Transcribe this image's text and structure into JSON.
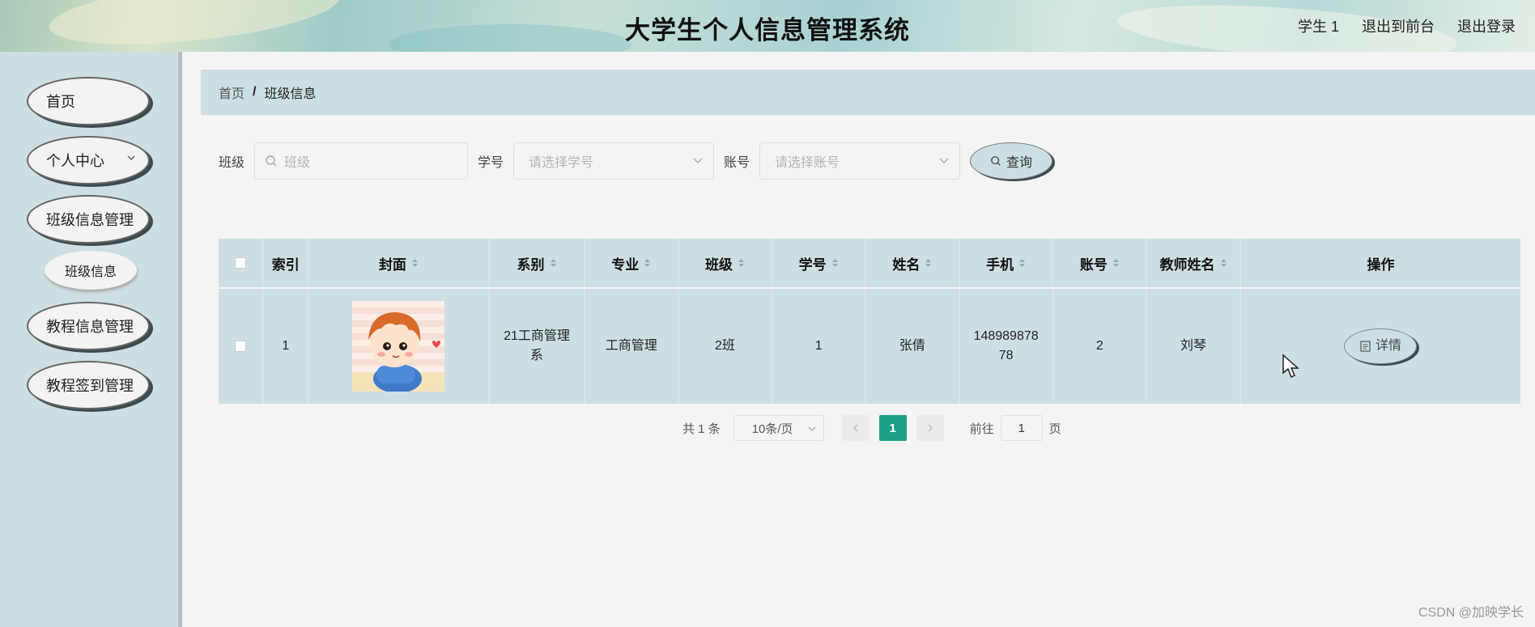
{
  "header": {
    "title": "大学生个人信息管理系统",
    "user": "学生 1",
    "to_front": "退出到前台",
    "logout": "退出登录"
  },
  "sidebar": {
    "items": [
      {
        "label": "首页"
      },
      {
        "label": "个人中心"
      },
      {
        "label": "班级信息管理"
      },
      {
        "label": "教程信息管理"
      },
      {
        "label": "教程签到管理"
      }
    ],
    "submenu": {
      "label": "班级信息"
    }
  },
  "breadcrumb": {
    "home": "首页",
    "separator": "/",
    "current": "班级信息"
  },
  "filters": {
    "class_label": "班级",
    "class_placeholder": "班级",
    "student_no_label": "学号",
    "student_no_placeholder": "请选择学号",
    "account_label": "账号",
    "account_placeholder": "请选择账号",
    "query_button": "查询"
  },
  "table": {
    "headers": [
      "索引",
      "封面",
      "系别",
      "专业",
      "班级",
      "学号",
      "姓名",
      "手机",
      "账号",
      "教师姓名",
      "操作"
    ],
    "rows": [
      {
        "index": "1",
        "department": "21工商管理系",
        "major": "工商管理",
        "class": "2班",
        "student_no": "1",
        "name": "张倩",
        "phone": "14898987878",
        "account": "2",
        "teacher": "刘琴",
        "action": "详情"
      }
    ]
  },
  "pagination": {
    "total": "共 1 条",
    "page_size": "10条/页",
    "current_page": "1",
    "goto_label": "前往",
    "goto_value": "1",
    "page_unit": "页"
  },
  "watermark": "CSDN @加映学长",
  "colors": {
    "accent": "#1e9e85",
    "panel": "#cddfe2"
  }
}
